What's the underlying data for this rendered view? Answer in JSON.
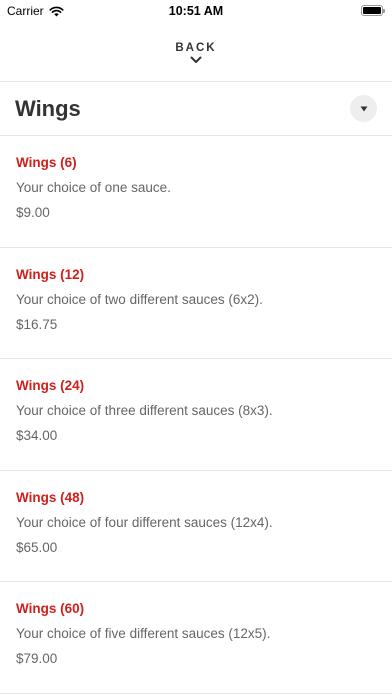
{
  "status_bar": {
    "carrier": "Carrier",
    "time": "10:51 AM",
    "icons": [
      "wifi-icon",
      "battery-icon"
    ]
  },
  "nav": {
    "back_label": "BACK",
    "back_icon": "chevron-down-icon"
  },
  "section": {
    "title": "Wings",
    "toggle_icon": "caret-down-icon"
  },
  "items": [
    {
      "name": "Wings (6)",
      "description": "Your choice of one sauce.",
      "price": "$9.00"
    },
    {
      "name": "Wings (12)",
      "description": "Your choice of two different sauces (6x2).",
      "price": "$16.75"
    },
    {
      "name": "Wings (24)",
      "description": "Your choice of three different sauces (8x3).",
      "price": "$34.00"
    },
    {
      "name": "Wings (48)",
      "description": "Your choice of four different sauces (12x4).",
      "price": "$65.00"
    },
    {
      "name": "Wings (60)",
      "description": "Your choice of five different sauces (12x5).",
      "price": "$79.00"
    }
  ],
  "colors": {
    "accent": "#d0201c",
    "text_secondary": "#666666",
    "divider": "#e6e6e6"
  }
}
